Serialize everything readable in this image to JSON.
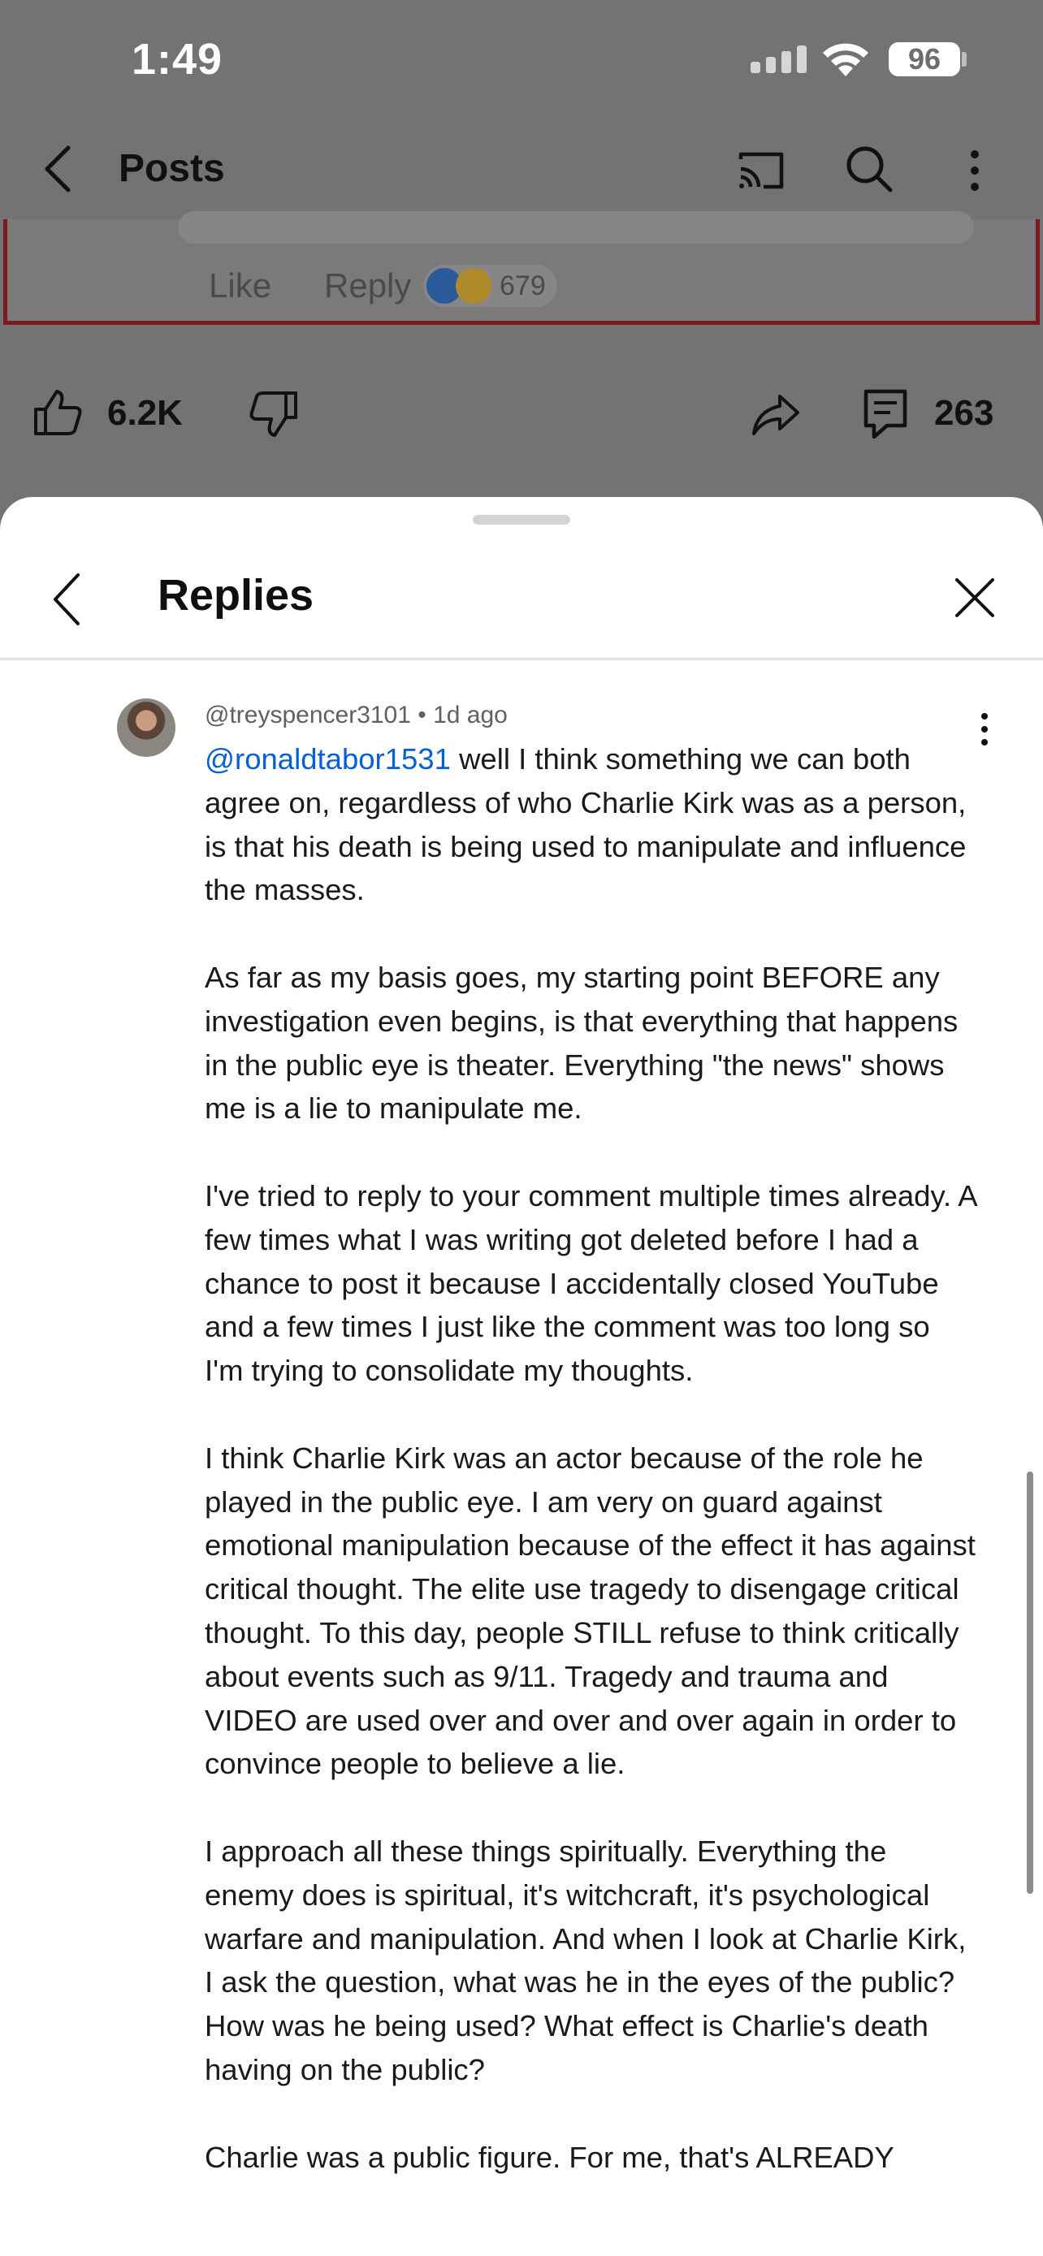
{
  "status_bar": {
    "time": "1:49",
    "battery": "96"
  },
  "header": {
    "title": "Posts"
  },
  "post_fragment": {
    "like_label": "Like",
    "reply_label": "Reply",
    "reaction_count": "679"
  },
  "action_bar": {
    "like_count": "6.2K",
    "comment_count": "263"
  },
  "sheet": {
    "title": "Replies"
  },
  "comment": {
    "author": "@treyspencer3101",
    "age": "1d ago",
    "meta": "@treyspencer3101 • 1d ago",
    "mention": "@ronaldtabor1531",
    "paragraphs": [
      " well I think something we can both agree on, regardless of who Charlie Kirk was as a person, is that his death is being used to manipulate and influence the masses.",
      "As far as my basis goes, my starting point BEFORE any investigation even begins, is that everything that happens in the public eye is theater. Everything \"the news\" shows me is a lie to manipulate me.",
      "I've tried to reply to your comment multiple times already. A few times what I was writing got deleted before I had a chance to post it because I accidentally closed YouTube and a few times I just like the comment was too long so I'm trying to consolidate my thoughts.",
      "I think Charlie Kirk was an actor because of the role he played in the public eye. I am very on guard against emotional manipulation because of the effect it has against critical thought. The elite use tragedy to disengage critical thought. To this day, people STILL refuse to think critically about events such as 9/11. Tragedy and trauma and VIDEO are used over and over and over again in order to convince people to believe a lie.",
      "I approach all these things spiritually. Everything the enemy does is spiritual, it's witchcraft, it's psychological warfare and manipulation. And when I look at Charlie Kirk, I ask the question, what was he in the eyes of the public? How was he being used? What effect is Charlie's death  having on the public?",
      "Charlie was a public figure. For me, that's ALREADY"
    ]
  },
  "icons": {
    "back": "chevron-left-icon",
    "cast": "cast-icon",
    "search": "search-icon",
    "more": "more-vert-icon",
    "like": "thumb-up-icon",
    "dislike": "thumb-down-icon",
    "share": "share-icon",
    "comment": "comment-icon",
    "close": "close-icon"
  }
}
